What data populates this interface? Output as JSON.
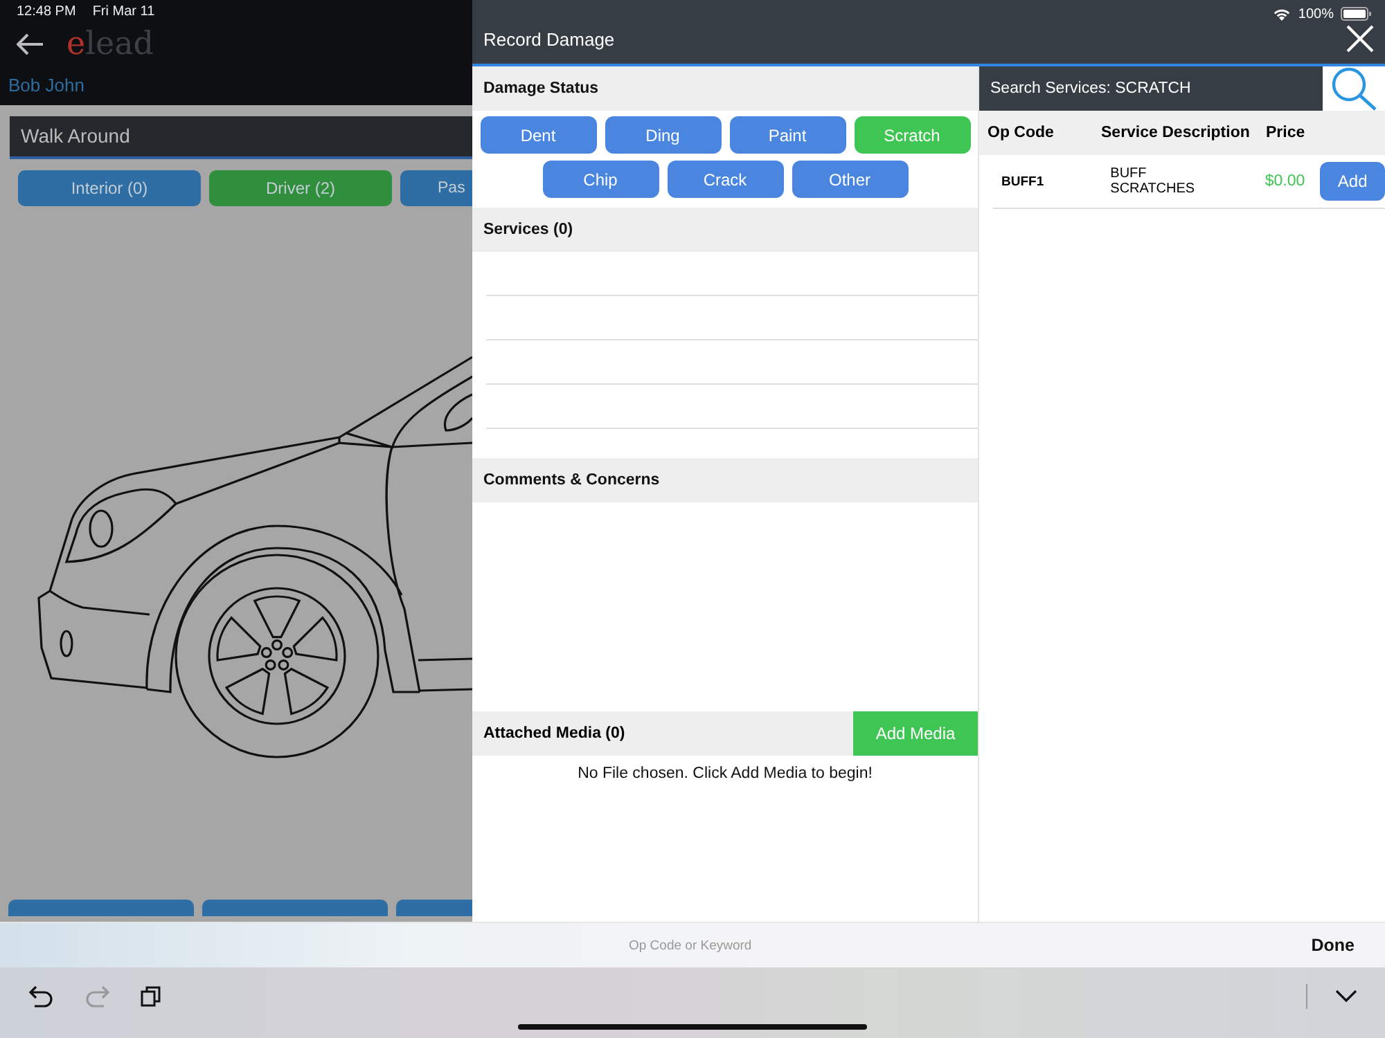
{
  "status_bar": {
    "time": "12:48 PM",
    "date": "Fri Mar 11",
    "battery": "100%"
  },
  "background_page": {
    "logo_first": "e",
    "logo_rest": "lead",
    "customer": "Bob John",
    "section": "Walk Around",
    "tabs": [
      {
        "label": "Interior (0)",
        "color": "#2e6ea5"
      },
      {
        "label": "Driver (2)",
        "color": "#2f8f3d"
      },
      {
        "label": "Pas",
        "color": "#2e6ea5"
      }
    ]
  },
  "modal": {
    "title": "Record Damage",
    "damage_status": {
      "heading": "Damage Status",
      "types": [
        {
          "label": "Dent",
          "selected": false
        },
        {
          "label": "Ding",
          "selected": false
        },
        {
          "label": "Paint",
          "selected": false
        },
        {
          "label": "Scratch",
          "selected": true
        },
        {
          "label": "Chip",
          "selected": false
        },
        {
          "label": "Crack",
          "selected": false
        },
        {
          "label": "Other",
          "selected": false
        }
      ]
    },
    "services": {
      "heading": "Services (0)"
    },
    "comments": {
      "heading": "Comments & Concerns"
    },
    "media": {
      "heading": "Attached Media (0)",
      "button": "Add Media",
      "empty_message": "No File chosen. Click Add Media to begin!"
    },
    "search": {
      "label": "Search Services: SCRATCH",
      "columns": [
        "Op Code",
        "Service Description",
        "Price"
      ],
      "rows": [
        {
          "op_code": "BUFF1",
          "description": "BUFF SCRATCHES",
          "price": "$0.00",
          "action": "Add"
        }
      ]
    }
  },
  "keyboard": {
    "placeholder": "Op Code or Keyword",
    "done": "Done"
  }
}
